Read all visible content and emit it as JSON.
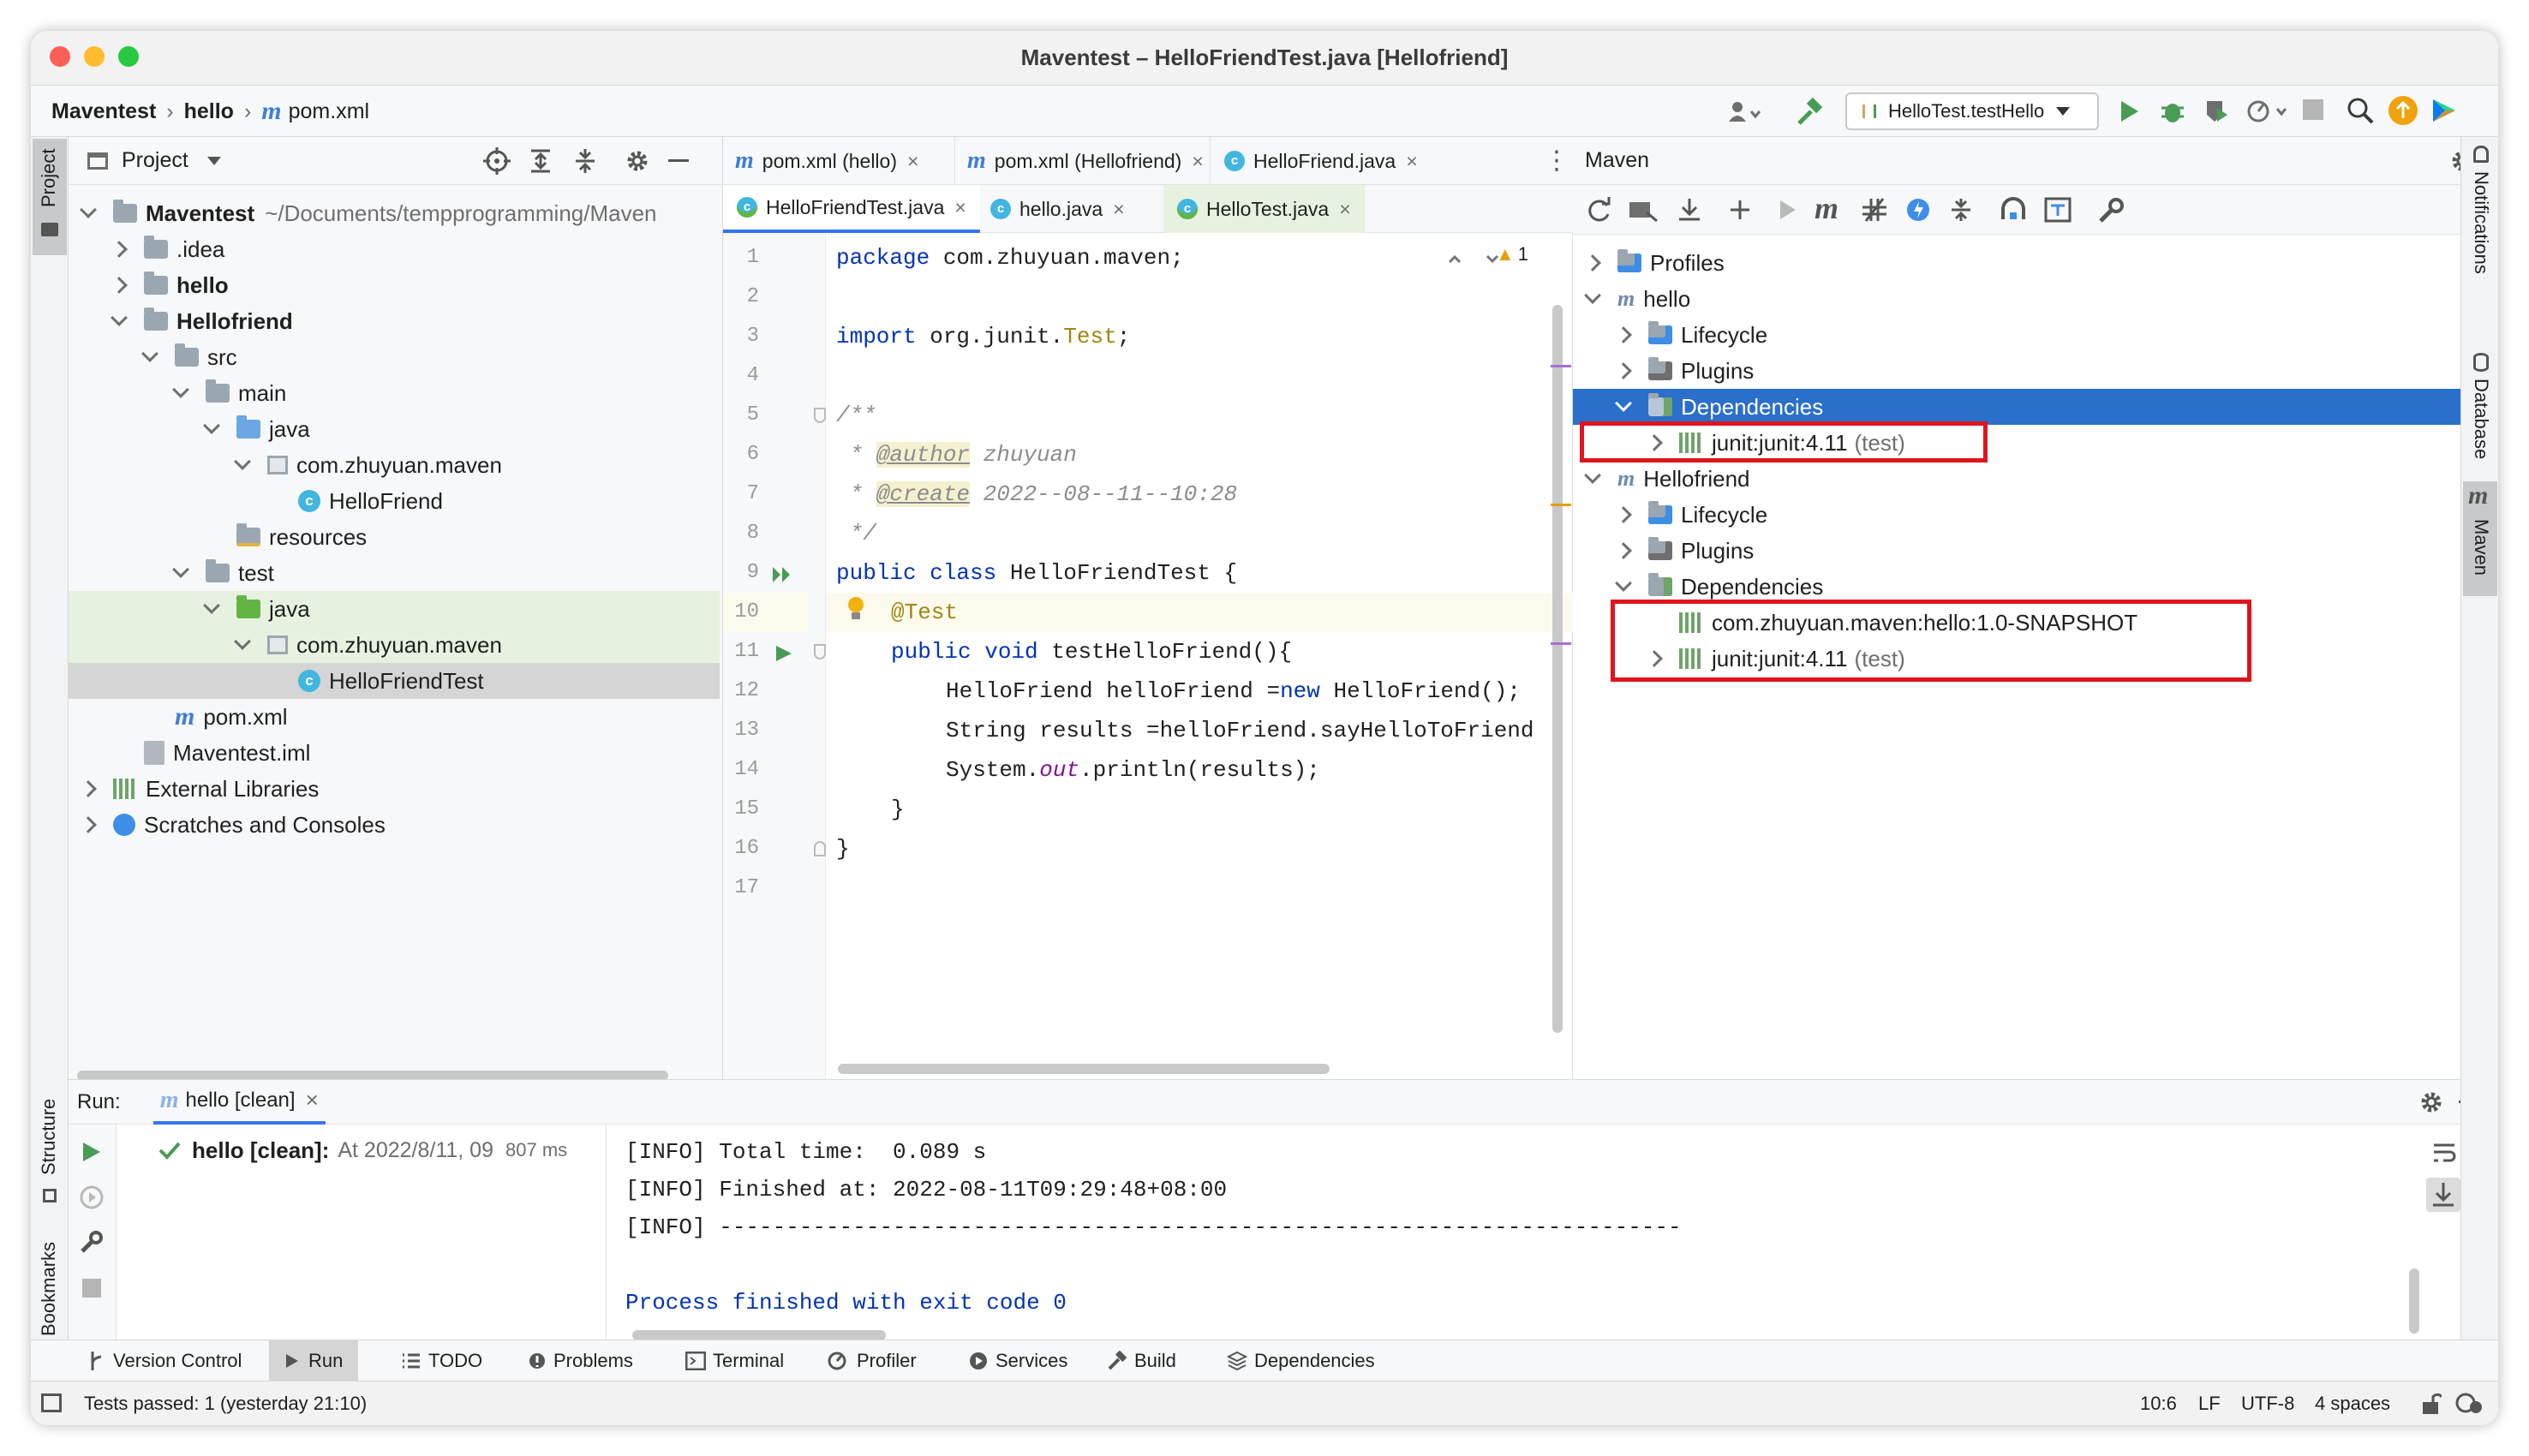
{
  "window": {
    "title": "Maventest – HelloFriendTest.java [Hellofriend]"
  },
  "breadcrumb": {
    "project": "Maventest",
    "module": "hello",
    "file": "pom.xml",
    "file_icon": "m"
  },
  "run_config": {
    "label": "HelloTest.testHello"
  },
  "left_stripe": {
    "project": "Project",
    "structure": "Structure",
    "bookmarks": "Bookmarks"
  },
  "right_stripe": {
    "notifications": "Notifications",
    "database": "Database",
    "maven": "Maven"
  },
  "project_panel": {
    "title": "Project",
    "tree": [
      {
        "label": "Maventest",
        "suffix": "~/Documents/tempprogramming/Maven",
        "icon": "folder-icon"
      },
      {
        "label": ".idea",
        "icon": "folder-icon"
      },
      {
        "label": "hello",
        "icon": "module-folder-icon"
      },
      {
        "label": "Hellofriend",
        "icon": "module-folder-icon"
      },
      {
        "label": "src",
        "icon": "folder-icon"
      },
      {
        "label": "main",
        "icon": "folder-icon"
      },
      {
        "label": "java",
        "icon": "source-folder-icon"
      },
      {
        "label": "com.zhuyuan.maven",
        "icon": "package-icon"
      },
      {
        "label": "HelloFriend",
        "icon": "class-icon"
      },
      {
        "label": "resources",
        "icon": "resources-folder-icon"
      },
      {
        "label": "test",
        "icon": "folder-icon"
      },
      {
        "label": "java",
        "icon": "test-folder-icon"
      },
      {
        "label": "com.zhuyuan.maven",
        "icon": "package-icon"
      },
      {
        "label": "HelloFriendTest",
        "icon": "class-icon"
      },
      {
        "label": "pom.xml",
        "icon": "maven-icon"
      },
      {
        "label": "Maventest.iml",
        "icon": "iml-icon"
      },
      {
        "label": "External Libraries",
        "icon": "library-icon"
      },
      {
        "label": "Scratches and Consoles",
        "icon": "scratches-icon"
      }
    ]
  },
  "editor": {
    "tabs_row1": [
      "pom.xml (hello)",
      "pom.xml (Hellofriend)",
      "HelloFriend.java"
    ],
    "tabs_row2": [
      "HelloFriendTest.java",
      "hello.java",
      "HelloTest.java"
    ],
    "warning_count": "1",
    "line_numbers": [
      "1",
      "2",
      "3",
      "4",
      "5",
      "6",
      "7",
      "8",
      "9",
      "10",
      "11",
      "12",
      "13",
      "14",
      "15",
      "16",
      "17"
    ],
    "code": {
      "l1_kw": "package",
      "l1_rest": " com.zhuyuan.maven;",
      "l3_kw": "import",
      "l3_rest": " org.junit.",
      "l3_ann": "Test",
      "l3_end": ";",
      "l5": "/**",
      "l6_star": " * ",
      "l6_tag": "@author",
      "l6_rest": " zhuyuan",
      "l7_star": " * ",
      "l7_tag": "@create",
      "l7_rest": " 2022--08--11--10:28",
      "l8": " */",
      "l9_kw": "public class",
      "l9_rest": " HelloFriendTest {",
      "l10_ann": "@Test",
      "l11_kw": "public void",
      "l11_rest": " testHelloFriend(){",
      "l12_a": "HelloFriend helloFriend =",
      "l12_kw": "new",
      "l12_b": " HelloFriend();",
      "l13": "String results =helloFriend.sayHelloToFriend",
      "l14_a": "System.",
      "l14_fld": "out",
      "l14_b": ".println(results);",
      "l15": "}",
      "l16": "}"
    }
  },
  "maven": {
    "title": "Maven",
    "tree": [
      {
        "label": "Profiles"
      },
      {
        "label": "hello"
      },
      {
        "label": "Lifecycle"
      },
      {
        "label": "Plugins"
      },
      {
        "label": "Dependencies",
        "selected": true
      },
      {
        "label": "junit:junit:4.11",
        "scope": "(test)"
      },
      {
        "label": "Hellofriend"
      },
      {
        "label": "Lifecycle"
      },
      {
        "label": "Plugins"
      },
      {
        "label": "Dependencies"
      },
      {
        "label": "com.zhuyuan.maven:hello:1.0-SNAPSHOT"
      },
      {
        "label": "junit:junit:4.11",
        "scope": "(test)"
      }
    ]
  },
  "run_panel": {
    "label": "Run:",
    "tab": "hello [clean]",
    "result_title": "hello [clean]:",
    "result_detail": "At 2022/8/11, 09",
    "result_time": "807 ms",
    "console": [
      "[INFO] Total time:  0.089 s",
      "[INFO] Finished at: 2022-08-11T09:29:48+08:00",
      "[INFO] ------------------------------------------------------------------------",
      "",
      "Process finished with exit code 0"
    ]
  },
  "tool_tabs": [
    "Version Control",
    "Run",
    "TODO",
    "Problems",
    "Terminal",
    "Profiler",
    "Services",
    "Build",
    "Dependencies"
  ],
  "status_bar": {
    "message": "Tests passed: 1 (yesterday 21:10)",
    "position": "10:6",
    "line_sep": "LF",
    "encoding": "UTF-8",
    "indent": "4 spaces"
  },
  "colors": {
    "selection": "#2a6fc9",
    "highlight_box": "#e0141e",
    "run_green": "#499c54"
  }
}
